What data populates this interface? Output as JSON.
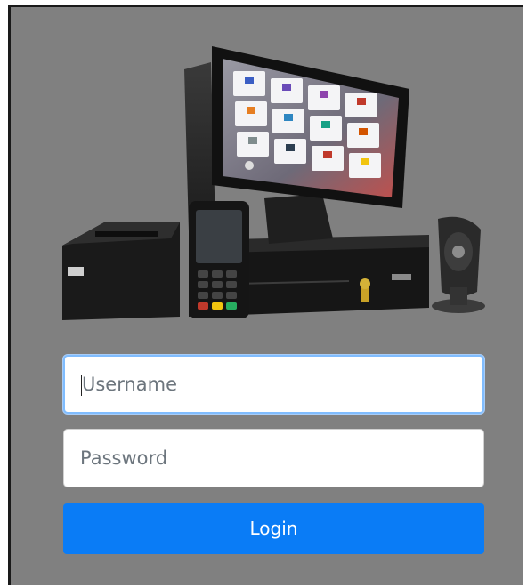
{
  "login": {
    "username_placeholder": "Username",
    "password_placeholder": "Password",
    "button_label": "Login"
  },
  "pos_screen_tiles": [
    {
      "color": "#3b5ec4"
    },
    {
      "color": "#6a4bb8"
    },
    {
      "color": "#8e44ad"
    },
    {
      "color": "#c0392b"
    },
    {
      "color": "#e67e22"
    },
    {
      "color": "#2e86c1"
    },
    {
      "color": "#16a085"
    },
    {
      "color": "#d35400"
    },
    {
      "color": "#7f8c8d"
    },
    {
      "color": "#2c3e50"
    },
    {
      "color": "#c0392b"
    },
    {
      "color": "#f1c40f"
    }
  ],
  "colors": {
    "background": "#808080",
    "button": "#0a7cf6",
    "focus_border": "#80bdff"
  }
}
